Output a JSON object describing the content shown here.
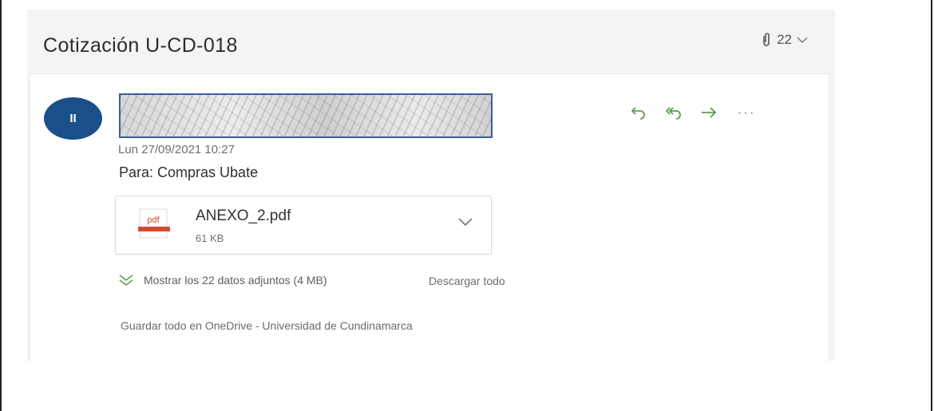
{
  "message": {
    "subject": "Cotización U-CD-018",
    "attachment_count": "22",
    "avatar_initials": "II",
    "date": "Lun 27/09/2021 10:27",
    "to_line": "Para:  Compras Ubate"
  },
  "actions": [
    {
      "name": "reply-icon",
      "glyph": "↶"
    },
    {
      "name": "reply-all-icon",
      "glyph": "⮪"
    },
    {
      "name": "forward-icon",
      "glyph": "→"
    },
    {
      "name": "more-options-icon",
      "glyph": "···"
    }
  ],
  "attachment": {
    "file_name": "ANEXO_2.pdf",
    "file_size": "61 KB",
    "icon_text": "pdf",
    "icon": "pdf-file-icon"
  },
  "attachments_bar": {
    "show_all_label": "Mostrar los 22 datos adjuntos (4 MB)",
    "download_all_label": "Descargar todo",
    "save_all_label": "Guardar todo en OneDrive - Universidad de Cundinamarca"
  },
  "colors": {
    "avatar_bg": "#1b4f8a",
    "action_green": "#5e9c4a",
    "pdf_red": "#d64a2f"
  }
}
